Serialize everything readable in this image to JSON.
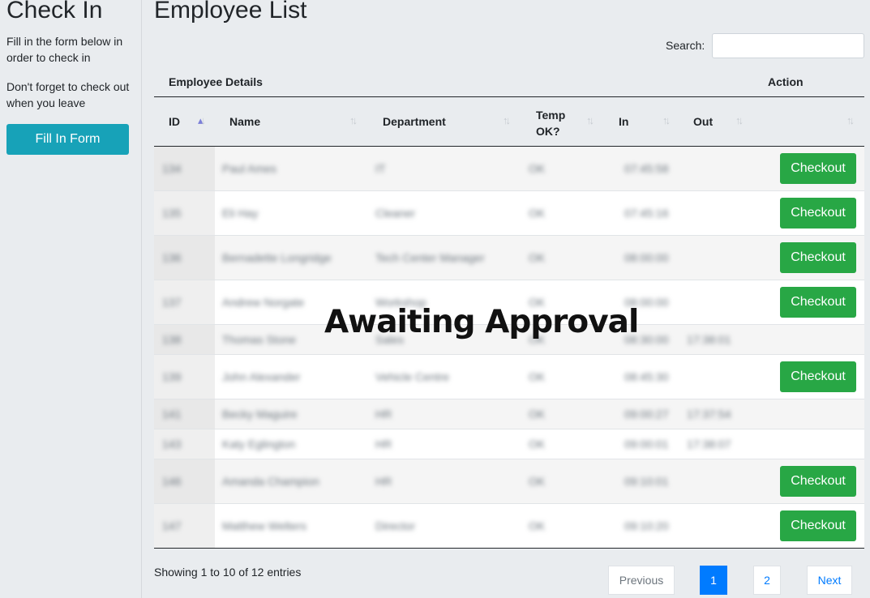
{
  "sidebar": {
    "title": "Check In",
    "text1": "Fill in the form below in order to check in",
    "text2": "Don't forget to check out when you leave",
    "button": "Fill In Form"
  },
  "main": {
    "title": "Employee List",
    "search_label": "Search:",
    "search_value": "",
    "group_headers": [
      "Employee Details",
      "Action"
    ],
    "columns": [
      "ID",
      "Name",
      "Department",
      "Temp OK?",
      "In",
      "Out"
    ],
    "rows": [
      {
        "id": "134",
        "name": "Paul Ames",
        "dept": "IT",
        "temp": "OK",
        "in": "07:45:58",
        "out": "",
        "action": "Checkout"
      },
      {
        "id": "135",
        "name": "Eli Hay",
        "dept": "Cleaner",
        "temp": "OK",
        "in": "07:45:16",
        "out": "",
        "action": "Checkout"
      },
      {
        "id": "136",
        "name": "Bernadette Longridge",
        "dept": "Tech Center Manager",
        "temp": "OK",
        "in": "08:00:00",
        "out": "",
        "action": "Checkout"
      },
      {
        "id": "137",
        "name": "Andrew Norgate",
        "dept": "Workshop",
        "temp": "OK",
        "in": "08:00:00",
        "out": "",
        "action": "Checkout"
      },
      {
        "id": "138",
        "name": "Thomas Stone",
        "dept": "Sales",
        "temp": "OK",
        "in": "08:30:00",
        "out": "17:38:01",
        "action": ""
      },
      {
        "id": "139",
        "name": "John Alexander",
        "dept": "Vehicle Centre",
        "temp": "OK",
        "in": "08:45:30",
        "out": "",
        "action": "Checkout"
      },
      {
        "id": "141",
        "name": "Becky Maguire",
        "dept": "HR",
        "temp": "OK",
        "in": "09:00:27",
        "out": "17:37:54",
        "action": ""
      },
      {
        "id": "143",
        "name": "Katy Eglington",
        "dept": "HR",
        "temp": "OK",
        "in": "09:00:01",
        "out": "17:38:07",
        "action": ""
      },
      {
        "id": "146",
        "name": "Amanda Champion",
        "dept": "HR",
        "temp": "OK",
        "in": "09:10:01",
        "out": "",
        "action": "Checkout"
      },
      {
        "id": "147",
        "name": "Matthew Welters",
        "dept": "Director",
        "temp": "OK",
        "in": "09:10:20",
        "out": "",
        "action": "Checkout"
      }
    ],
    "overlay": "Awaiting Approval",
    "info": "Showing 1 to 10 of 12 entries",
    "pagination": {
      "previous": "Previous",
      "page1": "1",
      "page2": "2",
      "next": "Next"
    }
  }
}
